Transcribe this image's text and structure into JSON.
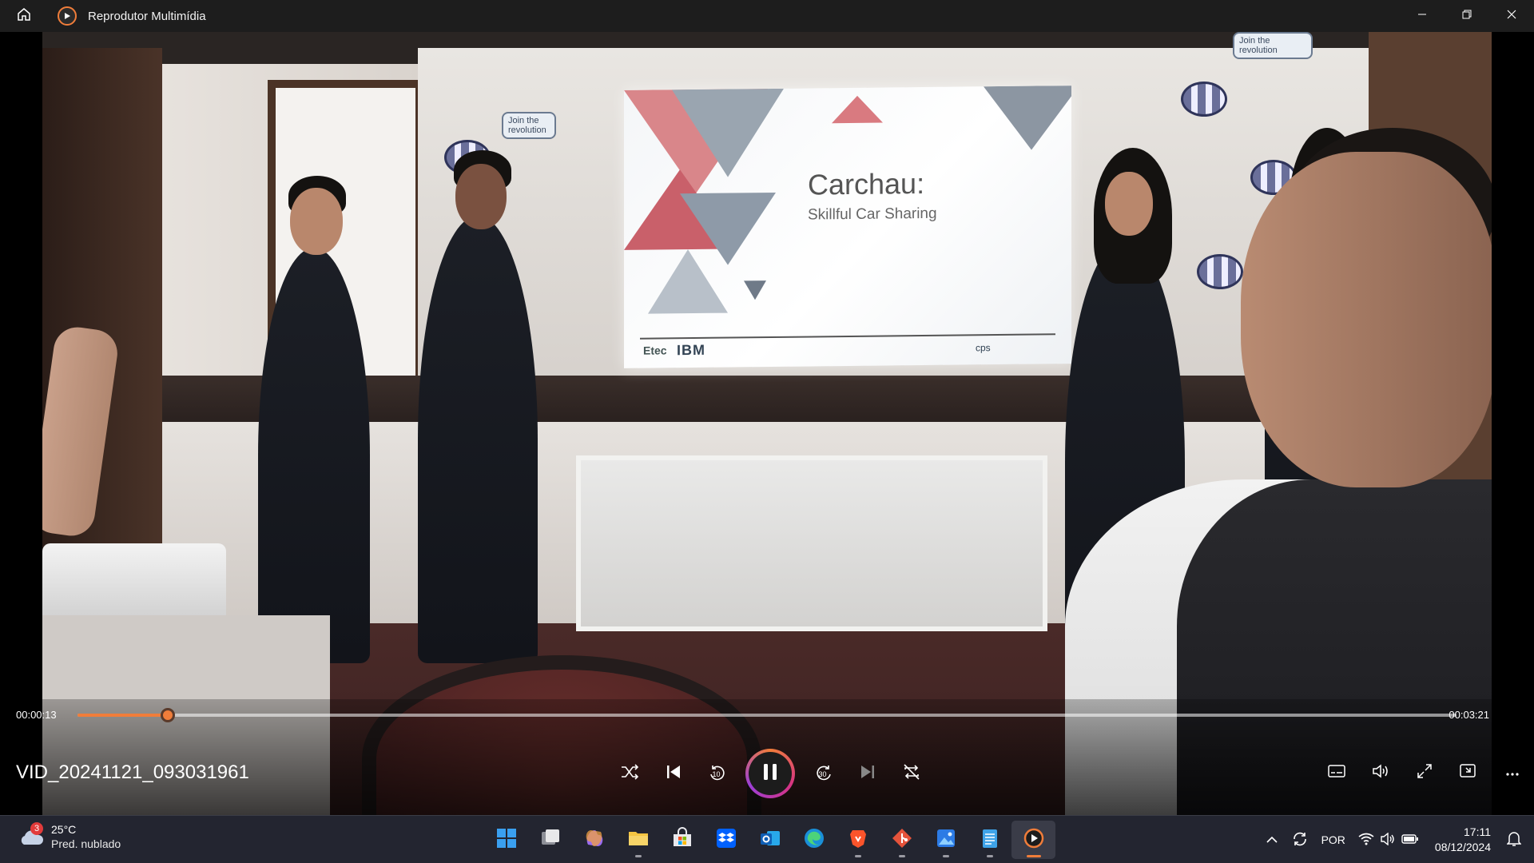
{
  "window": {
    "title": "Reprodutor Multimídia",
    "icons": [
      "home-icon",
      "media-player-icon",
      "minimize-icon",
      "restore-icon",
      "close-icon"
    ]
  },
  "slide": {
    "title": "Carchau:",
    "subtitle": "Skillful Car Sharing",
    "logo_left": "Etec",
    "logo_ibm": "IBM",
    "logo_right": "cps"
  },
  "stickers": [
    "Join the revolution",
    "Join the revolution"
  ],
  "player": {
    "current_time": "00:00:13",
    "total_time": "00:03:21",
    "progress_fraction": 0.0656,
    "video_title": "VID_20241121_093031961",
    "accent_color": "#f07d3a",
    "controls": [
      "shuffle-icon",
      "previous-icon",
      "rewind-10-icon",
      "pause-icon",
      "forward-30-icon",
      "next-icon",
      "repeat-off-icon"
    ],
    "skip_back_label": "10",
    "skip_forward_label": "30",
    "right_controls": [
      "subtitles-icon",
      "volume-icon",
      "fullscreen-icon",
      "mini-player-icon",
      "more-icon"
    ]
  },
  "taskbar": {
    "weather": {
      "badge": "3",
      "temp": "25°C",
      "desc": "Pred. nublado"
    },
    "apps": [
      "windows-start-icon",
      "task-view-icon",
      "copilot-icon",
      "file-explorer-icon",
      "microsoft-store-icon",
      "dropbox-icon",
      "outlook-icon",
      "edge-icon",
      "brave-icon",
      "git-icon",
      "photos-icon",
      "notepad-icon",
      "media-player-icon"
    ],
    "tray": {
      "language": "POR",
      "time": "17:11",
      "date": "08/12/2024"
    }
  }
}
